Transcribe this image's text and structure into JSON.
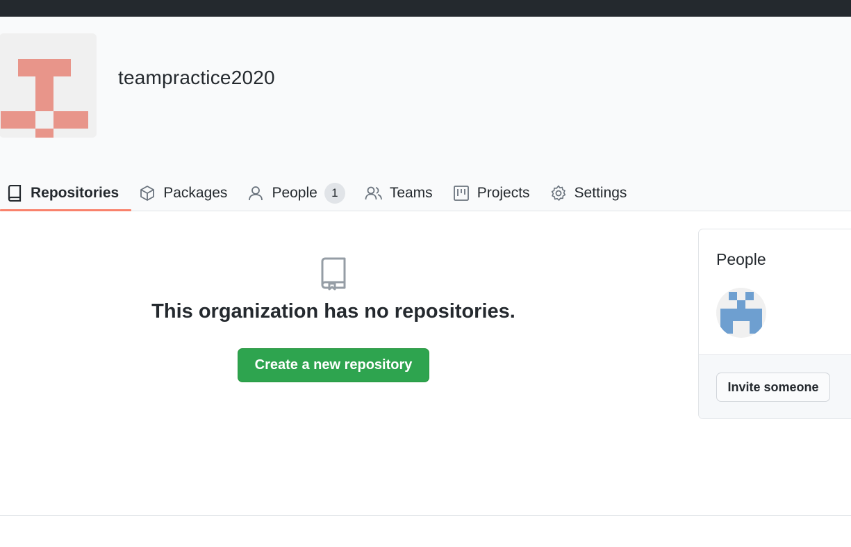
{
  "org": {
    "name": "teampractice2020",
    "avatar_color": "#e8958a"
  },
  "tabs": [
    {
      "label": "Repositories",
      "icon": "repo-icon",
      "active": true
    },
    {
      "label": "Packages",
      "icon": "package-icon"
    },
    {
      "label": "People",
      "icon": "person-icon",
      "count": "1"
    },
    {
      "label": "Teams",
      "icon": "people-icon"
    },
    {
      "label": "Projects",
      "icon": "project-icon"
    },
    {
      "label": "Settings",
      "icon": "gear-icon"
    }
  ],
  "blankslate": {
    "icon": "repo-icon",
    "heading": "This organization has no repositories.",
    "button_label": "Create a new repository"
  },
  "sidebar": {
    "people_title": "People",
    "member_avatar_color": "#6e9fd0",
    "invite_label": "Invite someone"
  },
  "colors": {
    "topbar": "#24292e",
    "active_tab_underline": "#f9826c",
    "primary_button": "#2ea44f"
  }
}
